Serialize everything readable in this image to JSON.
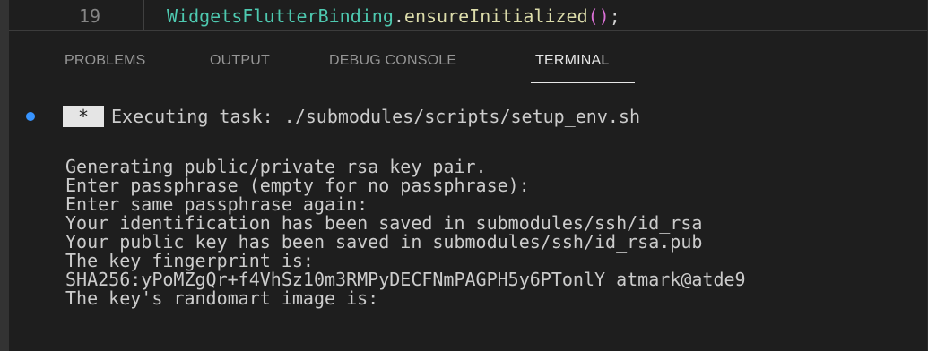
{
  "editor": {
    "line_number": "19",
    "code": {
      "class_name": "WidgetsFlutterBinding",
      "dot": ".",
      "method": "ensureInitialized",
      "parens": "()",
      "semicolon": ";"
    }
  },
  "panel": {
    "tabs": [
      {
        "label": "PROBLEMS",
        "active": false
      },
      {
        "label": "OUTPUT",
        "active": false
      },
      {
        "label": "DEBUG CONSOLE",
        "active": false
      },
      {
        "label": "TERMINAL",
        "active": true
      }
    ]
  },
  "terminal": {
    "task_marker": "*",
    "task_line": "Executing task: ./submodules/scripts/setup_env.sh",
    "lines": [
      "Generating public/private rsa key pair.",
      "Enter passphrase (empty for no passphrase):",
      "Enter same passphrase again:",
      "Your identification has been saved in submodules/ssh/id_rsa",
      "Your public key has been saved in submodules/ssh/id_rsa.pub",
      "The key fingerprint is:",
      "SHA256:yPoMZgQr+f4VhSz10m3RMPyDECFNmPAGPH5y6PTonlY atmark@atde9",
      "The key's randomart image is:"
    ]
  },
  "colors": {
    "background": "#1e1e1e",
    "accent": "#3794ff",
    "active_tab": "#e7e7e7",
    "inactive_tab": "#969696",
    "terminal_text": "#cccccc"
  }
}
